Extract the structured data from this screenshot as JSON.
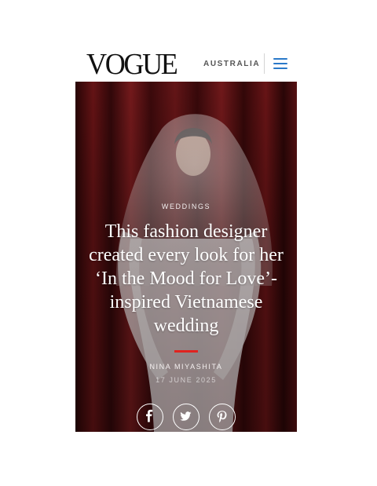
{
  "header": {
    "logo": "VOGUE",
    "edition": "AUSTRALIA",
    "menu_icon": "hamburger-menu-icon",
    "menu_color": "#2a79c9"
  },
  "article": {
    "category": "WEDDINGS",
    "headline": "This fashion designer created every look for her ‘In the Mood for Love’-inspired Vietnamese wedding",
    "author": "NINA MIYASHITA",
    "date": "17 JUNE 2025",
    "accent_color": "#e0231f"
  },
  "share": {
    "icons": [
      "facebook-icon",
      "twitter-icon",
      "pinterest-icon"
    ]
  }
}
